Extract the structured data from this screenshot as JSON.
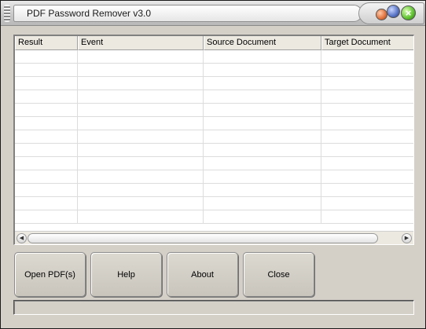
{
  "window": {
    "title": "PDF Password Remover v3.0"
  },
  "titlebar": {
    "controls": [
      {
        "icon": "minimize-orb-icon",
        "color": "#e0703a"
      },
      {
        "icon": "maximize-orb-icon",
        "color": "#5672c4"
      },
      {
        "icon": "close-orb-icon",
        "color": "#5cc12d",
        "glyph": "×"
      }
    ]
  },
  "list": {
    "columns": [
      {
        "label": "Result"
      },
      {
        "label": "Event"
      },
      {
        "label": "Source Document"
      },
      {
        "label": "Target Document"
      }
    ],
    "rows": []
  },
  "scrollbar": {
    "left_arrow": "◀",
    "right_arrow": "▶"
  },
  "buttons": {
    "open": "Open PDF(s)",
    "help": "Help",
    "about": "About",
    "close": "Close"
  },
  "status": {
    "text": ""
  }
}
